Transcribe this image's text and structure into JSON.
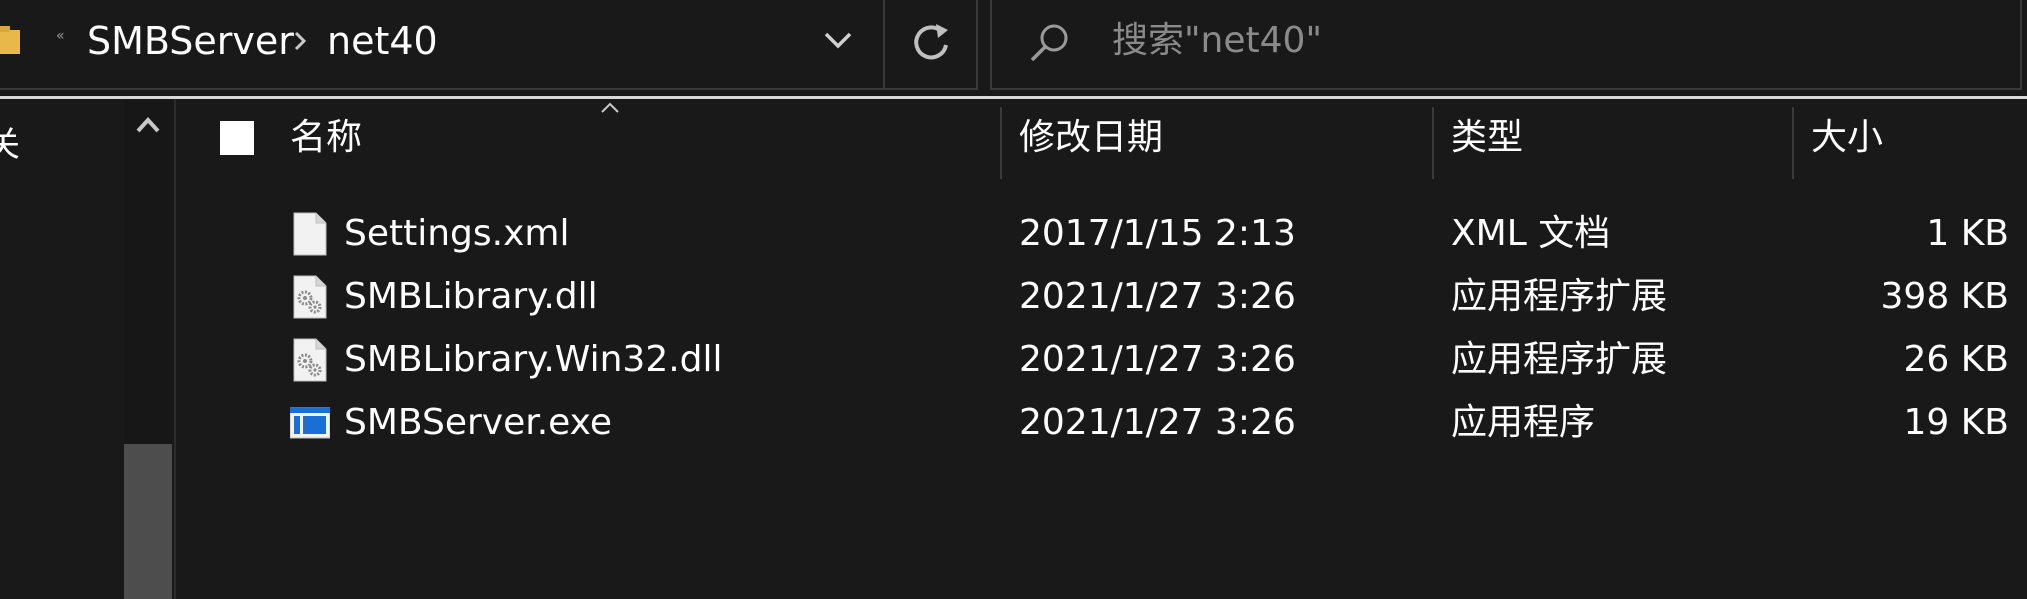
{
  "address_bar": {
    "overflow_glyph": "«",
    "breadcrumbs": [
      "SMBServer",
      "net40"
    ],
    "dropdown_icon": "chevron-down-icon",
    "refresh_icon": "refresh-icon"
  },
  "search": {
    "placeholder": "搜索\"net40\"",
    "icon": "search-icon"
  },
  "nav_pane": {
    "visible_label": "关"
  },
  "file_list": {
    "columns": [
      "名称",
      "修改日期",
      "类型",
      "大小"
    ],
    "sorted_column": "名称",
    "rows": [
      {
        "name": "Settings.xml",
        "modified": "2017/1/15 2:13",
        "type": "XML 文档",
        "size": "1 KB",
        "icon": "xml-document-icon"
      },
      {
        "name": "SMBLibrary.dll",
        "modified": "2021/1/27 3:26",
        "type": "应用程序扩展",
        "size": "398 KB",
        "icon": "dll-gear-icon"
      },
      {
        "name": "SMBLibrary.Win32.dll",
        "modified": "2021/1/27 3:26",
        "type": "应用程序扩展",
        "size": "26 KB",
        "icon": "dll-gear-icon"
      },
      {
        "name": "SMBServer.exe",
        "modified": "2021/1/27 3:26",
        "type": "应用程序",
        "size": "19 KB",
        "icon": "exe-application-icon"
      }
    ]
  },
  "colors": {
    "background": "#191919",
    "border": "#3a3a3a",
    "folder_yellow": "#e8b94a",
    "exe_blue": "#1a6fd6"
  }
}
